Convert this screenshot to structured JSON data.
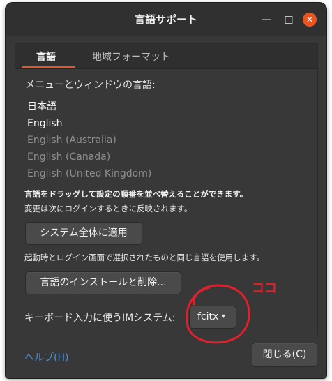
{
  "window": {
    "title": "言語サポート",
    "minimize_glyph": "—",
    "maximize_glyph": "□",
    "close_glyph": "✕"
  },
  "tabs": [
    {
      "label": "言語",
      "active": true
    },
    {
      "label": "地域フォーマット",
      "active": false
    }
  ],
  "language_section": {
    "heading": "メニューとウィンドウの言語:",
    "languages": [
      {
        "label": "日本語",
        "enabled": true
      },
      {
        "label": "English",
        "enabled": true
      },
      {
        "label": "English (Australia)",
        "enabled": false
      },
      {
        "label": "English (Canada)",
        "enabled": false
      },
      {
        "label": "English (United Kingdom)",
        "enabled": false
      }
    ],
    "drag_hint": "言語をドラッグして設定の順番を並べ替えることができます。",
    "change_note": "変更は次にログインするときに反映されます。"
  },
  "buttons": {
    "apply_system_wide": "システム全体に適用",
    "install_remove": "言語のインストールと削除...",
    "close": "閉じる(C)"
  },
  "apply_note": "起動時とログイン画面で選択されたものと同じ言語を使用します。",
  "im_system": {
    "label": "キーボード入力に使うIMシステム:",
    "selected": "fcitx",
    "caret": "▾"
  },
  "help_link": "ヘルプ(H)",
  "annotation": {
    "text": "ココ",
    "color": "#e0202a"
  },
  "colors": {
    "accent": "#e95420",
    "link": "#4a90d9",
    "window_bg": "#383838"
  }
}
